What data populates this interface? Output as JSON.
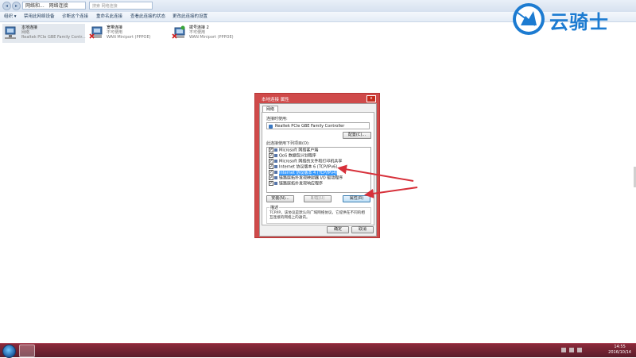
{
  "address_bar": {
    "crumbs": [
      "网络和...",
      "网络连接"
    ],
    "search_placeholder": "搜索 网络连接"
  },
  "command_bar": {
    "items": [
      "组织 ▾",
      "禁用此网络设备",
      "诊断这个连接",
      "重命名此连接",
      "查看此连接的状态",
      "更改此连接的设置"
    ]
  },
  "connections": [
    {
      "name": "本地连接",
      "status": "网络",
      "device": "Realtek PCIe GBE Family Contr..."
    },
    {
      "name": "宽带连接",
      "status": "不可使用",
      "device": "WAN Miniport (PPPOE)"
    },
    {
      "name": "拨号连接 2",
      "status": "不可使用",
      "device": "WAN Miniport (PPPOE)"
    }
  ],
  "dialog": {
    "title": "本地连接 属性",
    "close_glyph": "x",
    "tab": "网络",
    "connect_using_label": "连接时使用:",
    "adapter": "Realtek PCIe GBE Family Controller",
    "configure_button": "配置(C)...",
    "items_label": "此连接使用下列项目(O):",
    "items": [
      {
        "label": "Microsoft 网络客户端",
        "checked": true
      },
      {
        "label": "QoS 数据包计划程序",
        "checked": true
      },
      {
        "label": "Microsoft 网络的文件和打印机共享",
        "checked": true
      },
      {
        "label": "Internet 协议版本 6 (TCP/IPv6)",
        "checked": true
      },
      {
        "label": "Internet 协议版本 4 (TCP/IPv4)",
        "checked": true,
        "selected": true
      },
      {
        "label": "链路层拓扑发现映射器 I/O 驱动程序",
        "checked": true
      },
      {
        "label": "链路层拓扑发现响应程序",
        "checked": true
      }
    ],
    "install_button": "安装(N)...",
    "uninstall_button": "卸载(U)",
    "properties_button": "属性(R)",
    "description_title": "描述",
    "description_text": "TCP/IP。该协议是默认的广域网络协议，它提供在不同的相互连接的网络上的通讯。",
    "ok_button": "确定",
    "cancel_button": "取消"
  },
  "watermark": {
    "text": "云骑士"
  },
  "taskbar": {
    "time": "14:55",
    "date": "2016/10/14"
  }
}
